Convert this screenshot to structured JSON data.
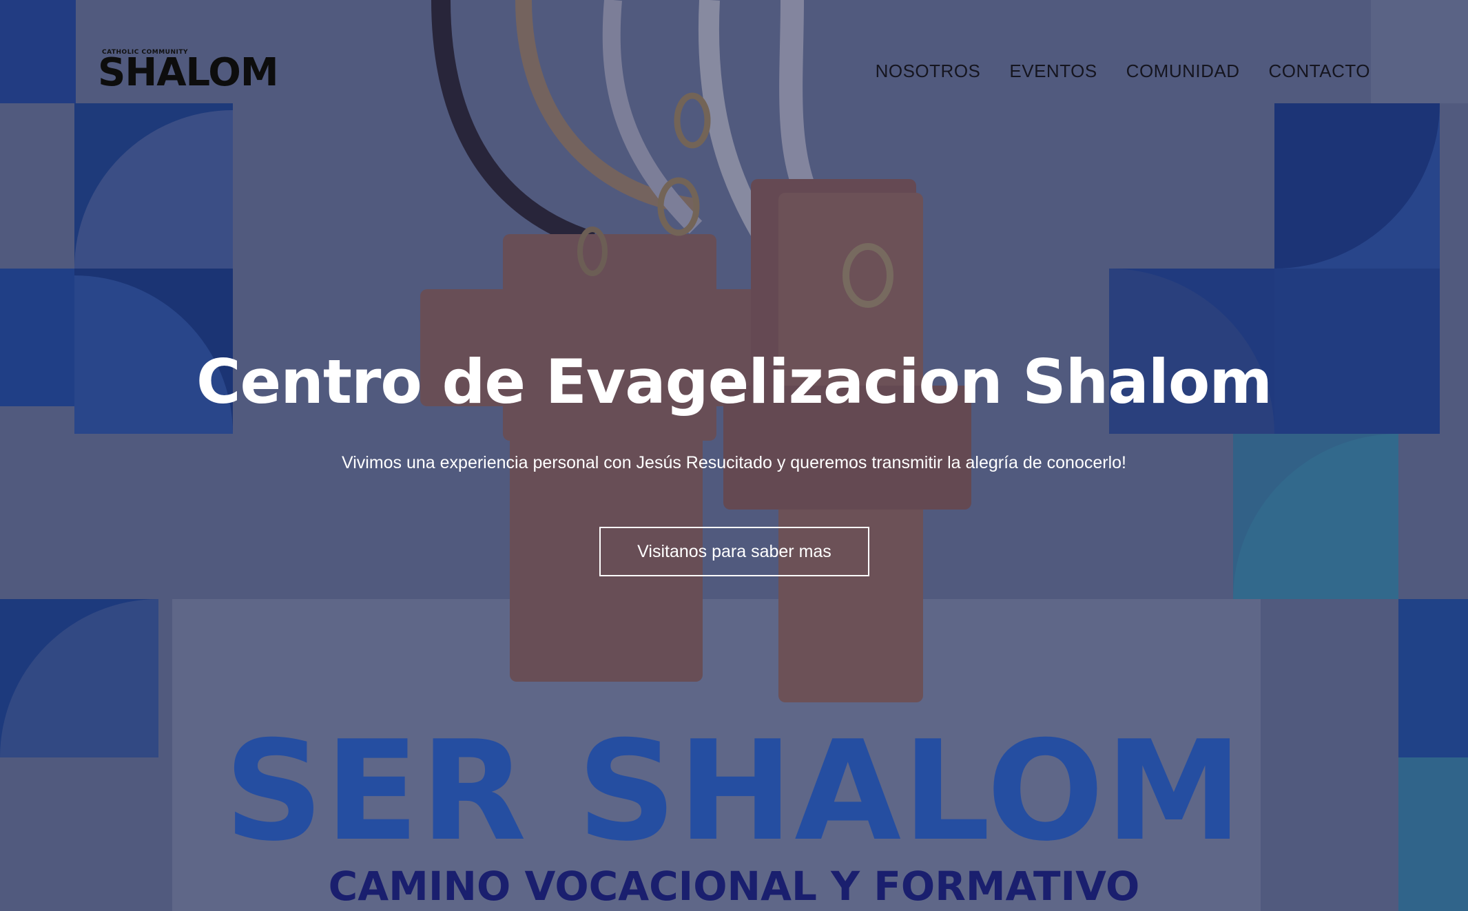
{
  "brand": {
    "logo_tagline": "CATHOLIC COMMUNITY",
    "logo_text": "SHALOM"
  },
  "nav": {
    "items": [
      {
        "label": "NOSOTROS"
      },
      {
        "label": "EVENTOS"
      },
      {
        "label": "COMUNIDAD"
      },
      {
        "label": "CONTACTO"
      }
    ]
  },
  "hero": {
    "title": "Centro de Evagelizacion Shalom",
    "subtitle": "Vivimos una experiencia personal con Jesús Resucitado y queremos transmitir la alegría de conocerlo!",
    "cta_label": "Visitanos para saber mas"
  },
  "background_poster": {
    "headline": "SER SHALOM",
    "subheadline": "CAMINO VOCACIONAL Y FORMATIVO"
  },
  "colors": {
    "overlay": "#262c50",
    "poster_blue": "#1c4aa6",
    "poster_navy": "#1a1f6e",
    "cross_wood": "#b0735c",
    "text_light": "#ffffff",
    "nav_text": "#15151f"
  }
}
